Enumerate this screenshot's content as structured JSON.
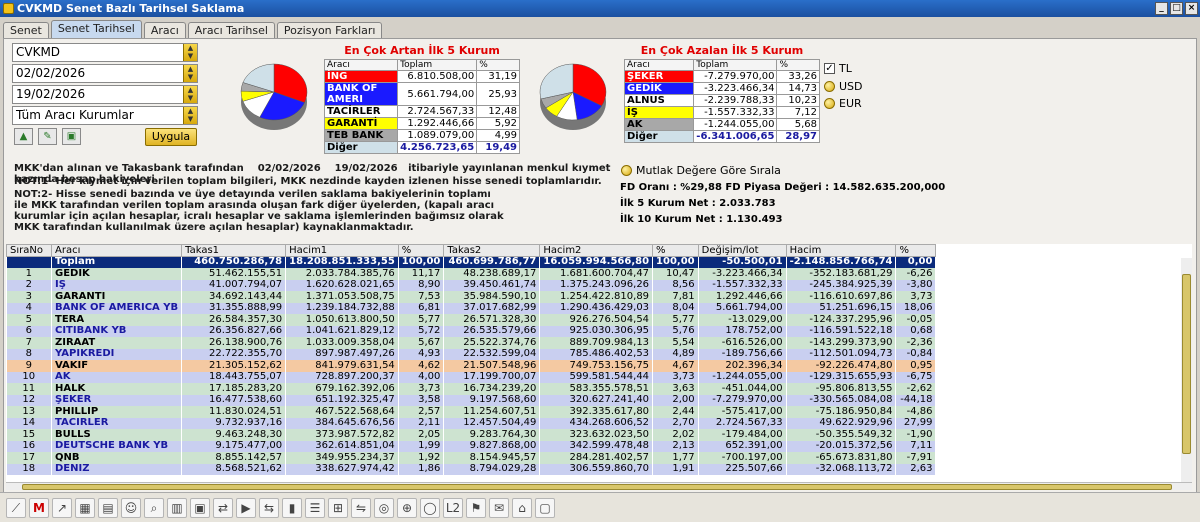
{
  "window": {
    "title": "CVKMD Senet Bazlı Tarihsel Saklama"
  },
  "tabs": [
    "Senet",
    "Senet Tarihsel",
    "Aracı",
    "Aracı Tarihsel",
    "Pozisyon Farkları"
  ],
  "active_tab": "Senet Tarihsel",
  "filters": {
    "security": "CVKMD",
    "start_date": "02/02/2026",
    "end_date": "19/02/2026",
    "institution": "Tüm Aracı Kurumlar",
    "apply_label": "Uygula"
  },
  "top5_up": {
    "title": "En Çok Artan İlk 5 Kurum",
    "headers": [
      "Aracı",
      "Toplam",
      "%"
    ],
    "rows": [
      {
        "name": "İNG",
        "total": "6.810.508,00",
        "pct": "31,19",
        "color": "#ff0000",
        "text": "#ffffff"
      },
      {
        "name": "BANK OF AMERI",
        "total": "5.661.794,00",
        "pct": "25,93",
        "color": "#1a1aff",
        "text": "#ffffff"
      },
      {
        "name": "TACİRLER",
        "total": "2.724.567,33",
        "pct": "12,48",
        "color": "#ffffff",
        "text": "#000000"
      },
      {
        "name": "GARANTİ",
        "total": "1.292.446,66",
        "pct": "5,92",
        "color": "#ffff00",
        "text": "#000000"
      },
      {
        "name": "TEB BANK",
        "total": "1.089.079,00",
        "pct": "4,99",
        "color": "#a8a8a8",
        "text": "#000000"
      },
      {
        "name": "Diğer",
        "total": "4.256.723,65",
        "pct": "19,49",
        "color": "#cfe0e8",
        "text": "#000000"
      }
    ]
  },
  "top5_down": {
    "title": "En Çok Azalan İlk 5 Kurum",
    "headers": [
      "Aracı",
      "Toplam",
      "%"
    ],
    "rows": [
      {
        "name": "ŞEKER",
        "total": "-7.279.970,00",
        "pct": "33,26",
        "color": "#ff0000",
        "text": "#ffffff"
      },
      {
        "name": "GEDİK",
        "total": "-3.223.466,34",
        "pct": "14,73",
        "color": "#1a1aff",
        "text": "#ffffff"
      },
      {
        "name": "ALNUS",
        "total": "-2.239.788,33",
        "pct": "10,23",
        "color": "#ffffff",
        "text": "#000000"
      },
      {
        "name": "İŞ",
        "total": "-1.557.332,33",
        "pct": "7,12",
        "color": "#ffff00",
        "text": "#000000"
      },
      {
        "name": "AK",
        "total": "-1.244.055,00",
        "pct": "5,68",
        "color": "#a8a8a8",
        "text": "#000000"
      },
      {
        "name": "Diğer",
        "total": "-6.341.006,65",
        "pct": "28,97",
        "color": "#cfe0e8",
        "text": "#000000"
      }
    ]
  },
  "currency": {
    "options": [
      "TL",
      "USD",
      "EUR"
    ],
    "selected": "TL"
  },
  "sort_absolute_label": "Mutlak Değere Göre Sırala",
  "info": {
    "line1_prefix": "MKK'dan alınan ve Takasbank tarafından",
    "line1_d1": "02/02/2026",
    "line1_d2": "19/02/2026",
    "line1_suffix": "itibariyle yayınlanan menkul kıymet bazında hesap bakiyeleri.",
    "note1": "NOT:1- Her kıymet için verilen toplam bilgileri, MKK nezdinde kayden izlenen hisse senedi toplamlarıdır.",
    "note2": "NOT:2- Hisse senedi bazında ve üye detayında verilen saklama bakiyelerinin toplamı ile MKK tarafından verilen toplam arasında oluşan fark diğer üyelerden, (kapalı aracı kurumlar için açılan hesaplar, icralı hesaplar ve saklama işlemlerinden bağımsız olarak MKK tarafından kullanılmak üzere açılan hesaplar) kaynaklanmaktadır."
  },
  "stats": {
    "fd": "FD Oranı : %29,88 FD Piyasa Değeri : 14.582.635.200,000",
    "top5": "İlk 5 Kurum Net : 2.033.783",
    "top10": "İlk 10 Kurum Net : 1.130.493"
  },
  "grid": {
    "headers": [
      "SıraNo",
      "Aracı",
      "Takas1",
      "Hacim1",
      "%",
      "Takas2",
      "Hacim2",
      "%",
      "Değişim/lot",
      "Hacim",
      "%"
    ],
    "total": [
      "",
      "Toplam",
      "460.750.286,78",
      "18.208.851.333,55",
      "100,00",
      "460.699.786,77",
      "16.059.994.566,80",
      "100,00",
      "-50.500,01",
      "-2.148.856.766,74",
      "0,00"
    ],
    "rows": [
      [
        "1",
        "GEDİK",
        "51.462.155,51",
        "2.033.784.385,76",
        "11,17",
        "48.238.689,17",
        "1.681.600.704,47",
        "10,47",
        "-3.223.466,34",
        "-352.183.681,29",
        "-6,26"
      ],
      [
        "2",
        "İŞ",
        "41.007.794,07",
        "1.620.628.021,65",
        "8,90",
        "39.450.461,74",
        "1.375.243.096,26",
        "8,56",
        "-1.557.332,33",
        "-245.384.925,39",
        "-3,80"
      ],
      [
        "3",
        "GARANTİ",
        "34.692.143,44",
        "1.371.053.508,75",
        "7,53",
        "35.984.590,10",
        "1.254.422.810,89",
        "7,81",
        "1.292.446,66",
        "-116.610.697,86",
        "3,73"
      ],
      [
        "4",
        "BANK OF AMERICA YB",
        "31.355.888,99",
        "1.239.184.732,88",
        "6,81",
        "37.017.682,99",
        "1.290.436.429,03",
        "8,04",
        "5.661.794,00",
        "51.251.696,15",
        "18,06"
      ],
      [
        "5",
        "TERA",
        "26.584.357,30",
        "1.050.613.800,50",
        "5,77",
        "26.571.328,30",
        "926.276.504,54",
        "5,77",
        "-13.029,00",
        "-124.337.295,96",
        "-0,05"
      ],
      [
        "6",
        "CİTİBANK YB",
        "26.356.827,66",
        "1.041.621.829,12",
        "5,72",
        "26.535.579,66",
        "925.030.306,95",
        "5,76",
        "178.752,00",
        "-116.591.522,18",
        "0,68"
      ],
      [
        "7",
        "ZİRAAT",
        "26.138.900,76",
        "1.033.009.358,04",
        "5,67",
        "25.522.374,76",
        "889.709.984,13",
        "5,54",
        "-616.526,00",
        "-143.299.373,90",
        "-2,36"
      ],
      [
        "8",
        "YAPIKREDİ",
        "22.722.355,70",
        "897.987.497,26",
        "4,93",
        "22.532.599,04",
        "785.486.402,53",
        "4,89",
        "-189.756,66",
        "-112.501.094,73",
        "-0,84"
      ],
      [
        "9",
        "VAKIF",
        "21.305.152,62",
        "841.979.631,54",
        "4,62",
        "21.507.548,96",
        "749.753.156,75",
        "4,67",
        "202.396,34",
        "-92.226.474,80",
        "0,95"
      ],
      [
        "10",
        "AK",
        "18.443.755,07",
        "728.897.200,37",
        "4,00",
        "17.199.700,07",
        "599.581.544,44",
        "3,73",
        "-1.244.055,00",
        "-129.315.655,93",
        "-6,75"
      ],
      [
        "11",
        "HALK",
        "17.185.283,20",
        "679.162.392,06",
        "3,73",
        "16.734.239,20",
        "583.355.578,51",
        "3,63",
        "-451.044,00",
        "-95.806.813,55",
        "-2,62"
      ],
      [
        "12",
        "ŞEKER",
        "16.477.538,60",
        "651.192.325,47",
        "3,58",
        "9.197.568,60",
        "320.627.241,40",
        "2,00",
        "-7.279.970,00",
        "-330.565.084,08",
        "-44,18"
      ],
      [
        "13",
        "PHİLLİP",
        "11.830.024,51",
        "467.522.568,64",
        "2,57",
        "11.254.607,51",
        "392.335.617,80",
        "2,44",
        "-575.417,00",
        "-75.186.950,84",
        "-4,86"
      ],
      [
        "14",
        "TACİRLER",
        "9.732.937,16",
        "384.645.676,56",
        "2,11",
        "12.457.504,49",
        "434.268.606,52",
        "2,70",
        "2.724.567,33",
        "49.622.929,96",
        "27,99"
      ],
      [
        "15",
        "BULLS",
        "9.463.248,30",
        "373.987.572,82",
        "2,05",
        "9.283.764,30",
        "323.632.023,50",
        "2,02",
        "-179.484,00",
        "-50.355.549,32",
        "-1,90"
      ],
      [
        "16",
        "DEUTSCHE BANK YB",
        "9.175.477,00",
        "362.614.851,04",
        "1,99",
        "9.827.868,00",
        "342.599.478,48",
        "2,13",
        "652.391,00",
        "-20.015.372,56",
        "7,11"
      ],
      [
        "17",
        "QNB",
        "8.855.142,57",
        "349.955.234,37",
        "1,92",
        "8.154.945,57",
        "284.281.402,57",
        "1,77",
        "-700.197,00",
        "-65.673.831,80",
        "-7,91"
      ],
      [
        "18",
        "DENİZ",
        "8.568.521,62",
        "338.627.974,42",
        "1,86",
        "8.794.029,28",
        "306.559.860,70",
        "1,91",
        "225.507,66",
        "-32.068.113,72",
        "2,63"
      ]
    ],
    "highlight_row": "9"
  },
  "toolbar": {
    "icons": [
      "chart-line-icon",
      "m-logo-icon",
      "trend-icon",
      "area-chart-icon",
      "table-icon",
      "people-icon",
      "search-icon",
      "grid-icon",
      "calculator-icon",
      "swap-icon",
      "play-icon",
      "compare-icon",
      "bars-icon",
      "ladder-icon",
      "hierarchy-icon",
      "transfer-icon",
      "coins-icon",
      "zoom-icon",
      "cylinder-icon",
      "l2-icon",
      "flag-icon",
      "news-icon",
      "bank-icon",
      "screen-icon"
    ]
  }
}
